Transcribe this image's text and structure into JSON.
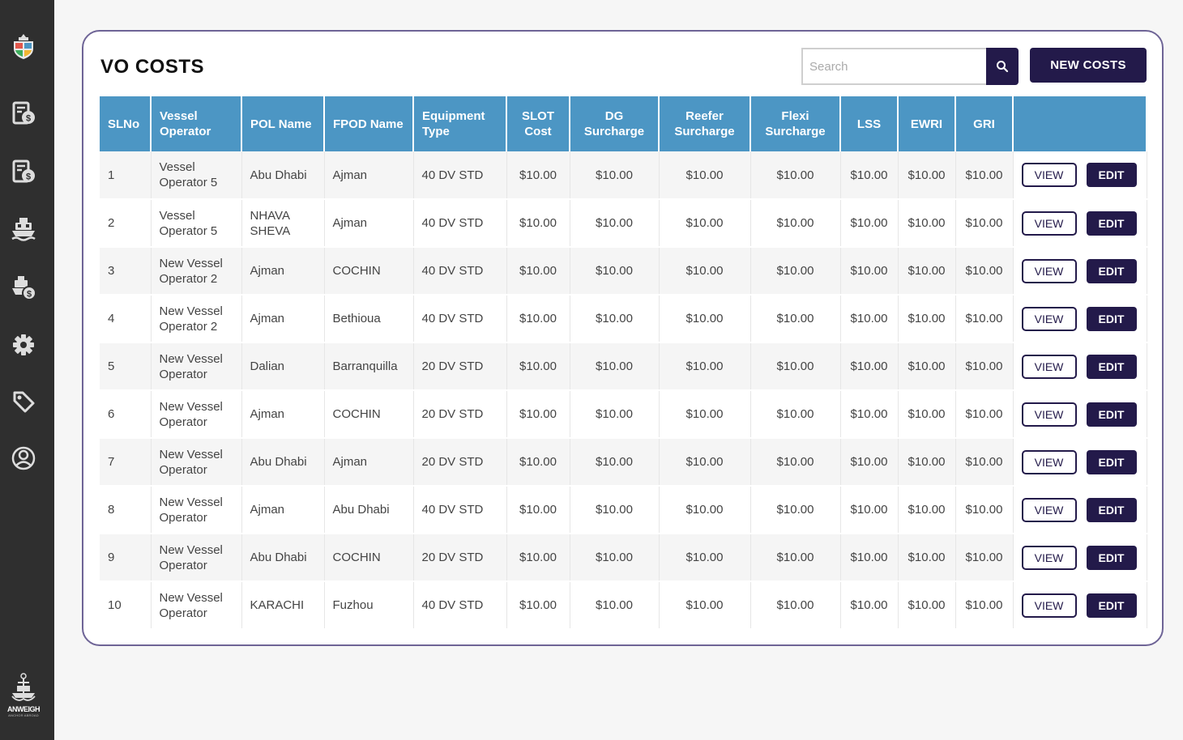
{
  "page": {
    "title": "VO COSTS"
  },
  "search": {
    "placeholder": "Search"
  },
  "new_button": {
    "label": "NEW COSTS"
  },
  "sidebar": {
    "items": [
      {
        "icon": "logo-shield-icon"
      },
      {
        "icon": "invoice-dollar-icon"
      },
      {
        "icon": "invoice-dollar-alt-icon"
      },
      {
        "icon": "ship-icon"
      },
      {
        "icon": "ship-dollar-icon"
      },
      {
        "icon": "gear-icon"
      },
      {
        "icon": "tag-icon"
      },
      {
        "icon": "user-circle-icon"
      }
    ],
    "brand": {
      "name": "ANWEIGH",
      "sub": "ANCHOR ABROAD"
    }
  },
  "colors": {
    "header": "#4c96c4",
    "primary": "#231a4a",
    "sidebar": "#2f2f2f",
    "card_border": "#6e6496"
  },
  "table": {
    "headers": [
      "SLNo",
      "Vessel Operator",
      "POL Name",
      "FPOD Name",
      "Equipment Type",
      "SLOT Cost",
      "DG Surcharge",
      "Reefer Surcharge",
      "Flexi Surcharge",
      "LSS",
      "EWRI",
      "GRI",
      ""
    ],
    "view_label": "VIEW",
    "edit_label": "EDIT",
    "rows": [
      [
        "1",
        "Vessel Operator 5",
        "Abu Dhabi",
        "Ajman",
        "40 DV STD",
        "$10.00",
        "$10.00",
        "$10.00",
        "$10.00",
        "$10.00",
        "$10.00",
        "$10.00"
      ],
      [
        "2",
        "Vessel Operator 5",
        "NHAVA SHEVA",
        "Ajman",
        "40 DV STD",
        "$10.00",
        "$10.00",
        "$10.00",
        "$10.00",
        "$10.00",
        "$10.00",
        "$10.00"
      ],
      [
        "3",
        "New Vessel Operator 2",
        "Ajman",
        "COCHIN",
        "40 DV STD",
        "$10.00",
        "$10.00",
        "$10.00",
        "$10.00",
        "$10.00",
        "$10.00",
        "$10.00"
      ],
      [
        "4",
        "New Vessel Operator 2",
        "Ajman",
        "Bethioua",
        "40 DV STD",
        "$10.00",
        "$10.00",
        "$10.00",
        "$10.00",
        "$10.00",
        "$10.00",
        "$10.00"
      ],
      [
        "5",
        "New Vessel Operator",
        "Dalian",
        "Barranquilla",
        "20 DV STD",
        "$10.00",
        "$10.00",
        "$10.00",
        "$10.00",
        "$10.00",
        "$10.00",
        "$10.00"
      ],
      [
        "6",
        "New Vessel Operator",
        "Ajman",
        "COCHIN",
        "20 DV STD",
        "$10.00",
        "$10.00",
        "$10.00",
        "$10.00",
        "$10.00",
        "$10.00",
        "$10.00"
      ],
      [
        "7",
        "New Vessel Operator",
        "Abu Dhabi",
        "Ajman",
        "20 DV STD",
        "$10.00",
        "$10.00",
        "$10.00",
        "$10.00",
        "$10.00",
        "$10.00",
        "$10.00"
      ],
      [
        "8",
        "New Vessel Operator",
        "Ajman",
        "Abu Dhabi",
        "40 DV STD",
        "$10.00",
        "$10.00",
        "$10.00",
        "$10.00",
        "$10.00",
        "$10.00",
        "$10.00"
      ],
      [
        "9",
        "New Vessel Operator",
        "Abu Dhabi",
        "COCHIN",
        "20 DV STD",
        "$10.00",
        "$10.00",
        "$10.00",
        "$10.00",
        "$10.00",
        "$10.00",
        "$10.00"
      ],
      [
        "10",
        "New Vessel Operator",
        "KARACHI",
        "Fuzhou",
        "40 DV STD",
        "$10.00",
        "$10.00",
        "$10.00",
        "$10.00",
        "$10.00",
        "$10.00",
        "$10.00"
      ]
    ]
  }
}
